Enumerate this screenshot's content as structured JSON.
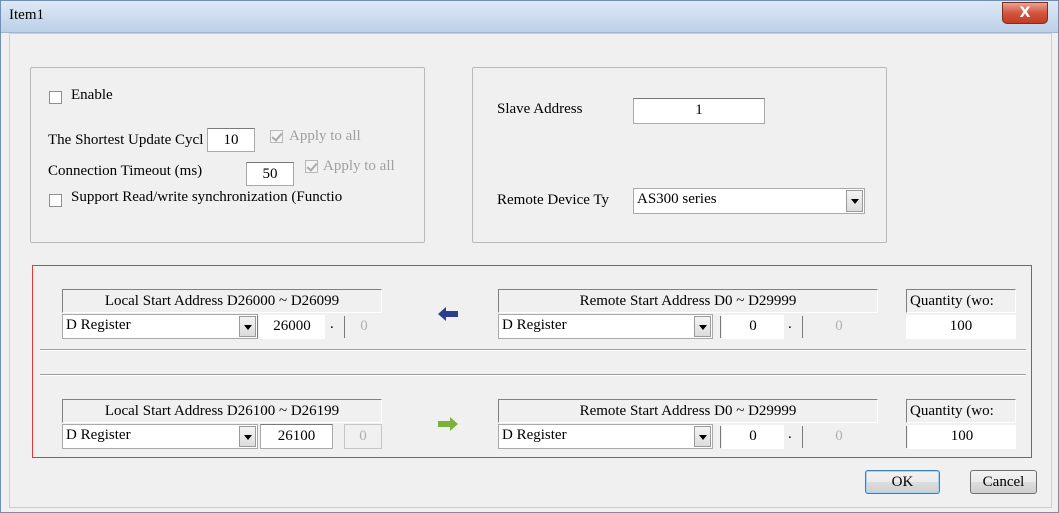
{
  "window": {
    "title": "Item1",
    "close_glyph": "X"
  },
  "general": {
    "enable_label": "Enable",
    "shortest_update_label": "The Shortest Update Cycl",
    "shortest_update_value": "10",
    "apply_all_1": "Apply to all",
    "timeout_label": "Connection Timeout (ms)",
    "timeout_value": "50",
    "apply_all_2": "Apply to all",
    "sync_label": "Support Read/write synchronization (Functio"
  },
  "slave": {
    "address_label": "Slave Address",
    "address_value": "1",
    "device_type_label": "Remote Device Ty",
    "device_type_value": "AS300 series"
  },
  "mapping_rows": [
    {
      "local_header": "Local Start Address D26000 ~ D26099",
      "local_type": "D Register",
      "local_address": "26000",
      "local_sep": ".",
      "local_bit": "0",
      "direction_icon": "left-arrow-icon",
      "direction_color": "#2b3f8f",
      "remote_header": "Remote Start Address D0 ~ D29999",
      "remote_type": "D Register",
      "remote_address": "0",
      "remote_sep": ".",
      "remote_bit": "0",
      "quantity_header": "Quantity (wo:",
      "quantity_value": "100"
    },
    {
      "local_header": "Local Start Address D26100 ~ D26199",
      "local_type": "D Register",
      "local_address": "26100",
      "local_sep": "",
      "local_bit": "0",
      "direction_icon": "right-arrow-icon",
      "direction_color": "#7bb33a",
      "remote_header": "Remote Start Address D0 ~ D29999",
      "remote_type": "D Register",
      "remote_address": "0",
      "remote_sep": ".",
      "remote_bit": "0",
      "quantity_header": "Quantity (wo:",
      "quantity_value": "100"
    }
  ],
  "buttons": {
    "ok": "OK",
    "cancel": "Cancel"
  }
}
